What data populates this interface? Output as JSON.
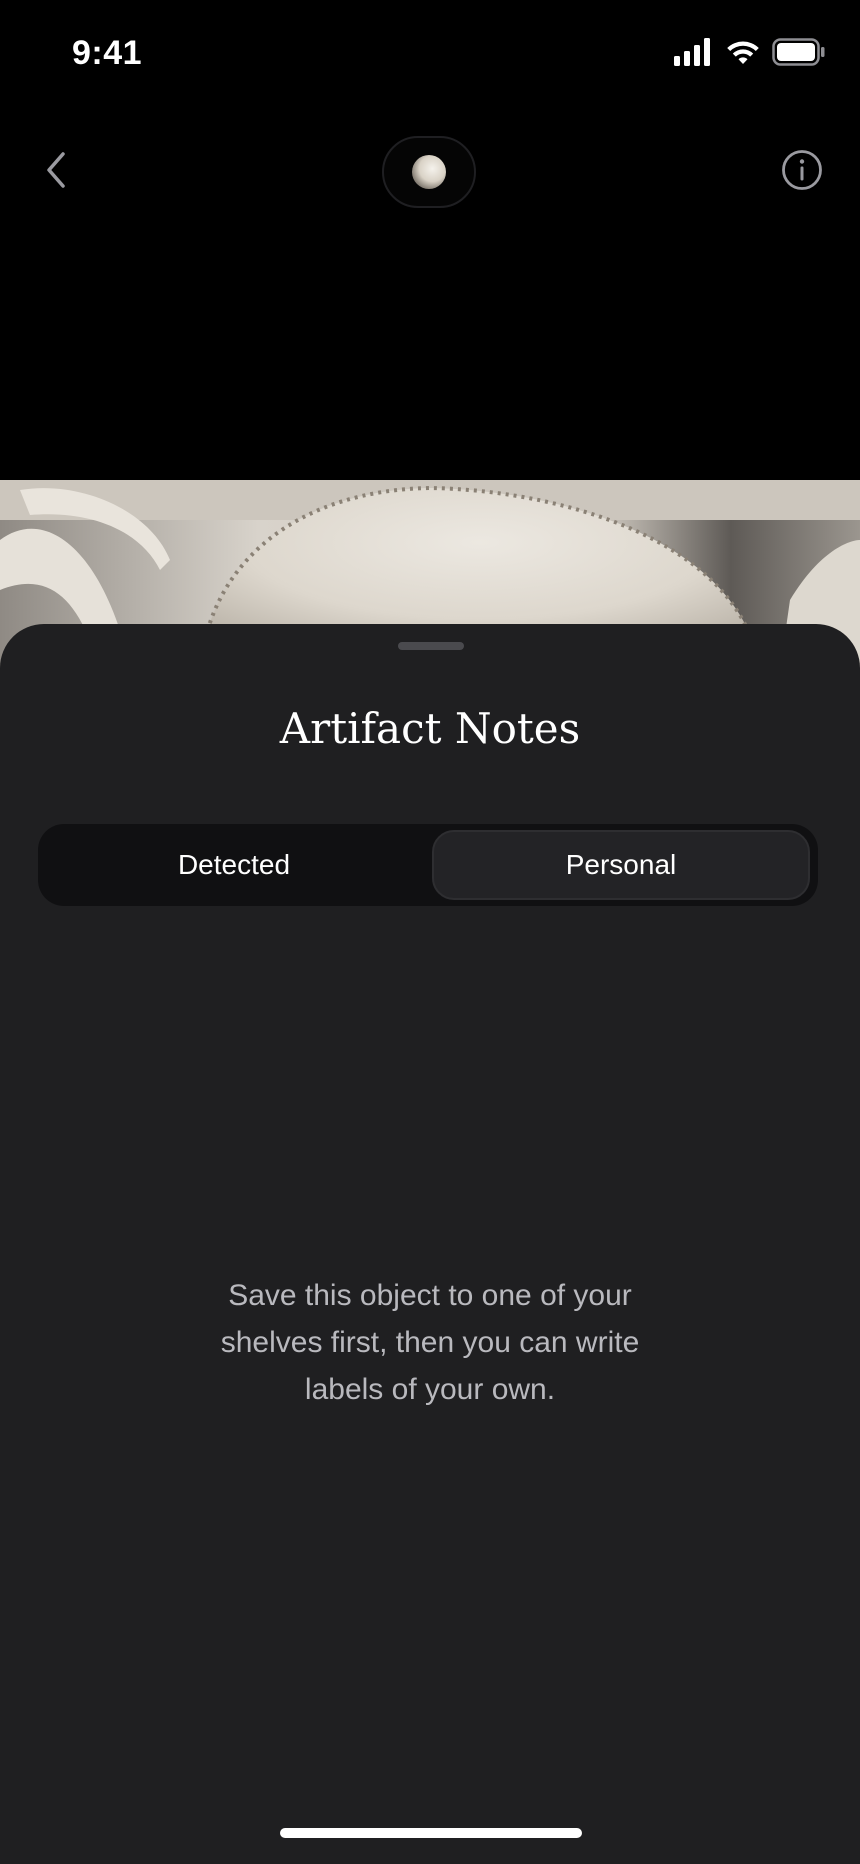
{
  "status_bar": {
    "time": "9:41",
    "icons": [
      "signal-icon",
      "wifi-icon",
      "battery-icon"
    ]
  },
  "nav": {
    "back_icon": "chevron-left-icon",
    "info_icon": "info-circle-icon"
  },
  "sheet": {
    "title": "Artifact Notes",
    "tabs": [
      {
        "label": "Detected",
        "selected": false
      },
      {
        "label": "Personal",
        "selected": true
      }
    ],
    "empty_message": "Save this object to one of your shelves first, then you can write labels of your own."
  },
  "colors": {
    "background": "#000000",
    "sheet": "#1f1f21",
    "segment_track": "#101012",
    "segment_selected": "#232326",
    "secondary_text": "#b9b9be"
  }
}
